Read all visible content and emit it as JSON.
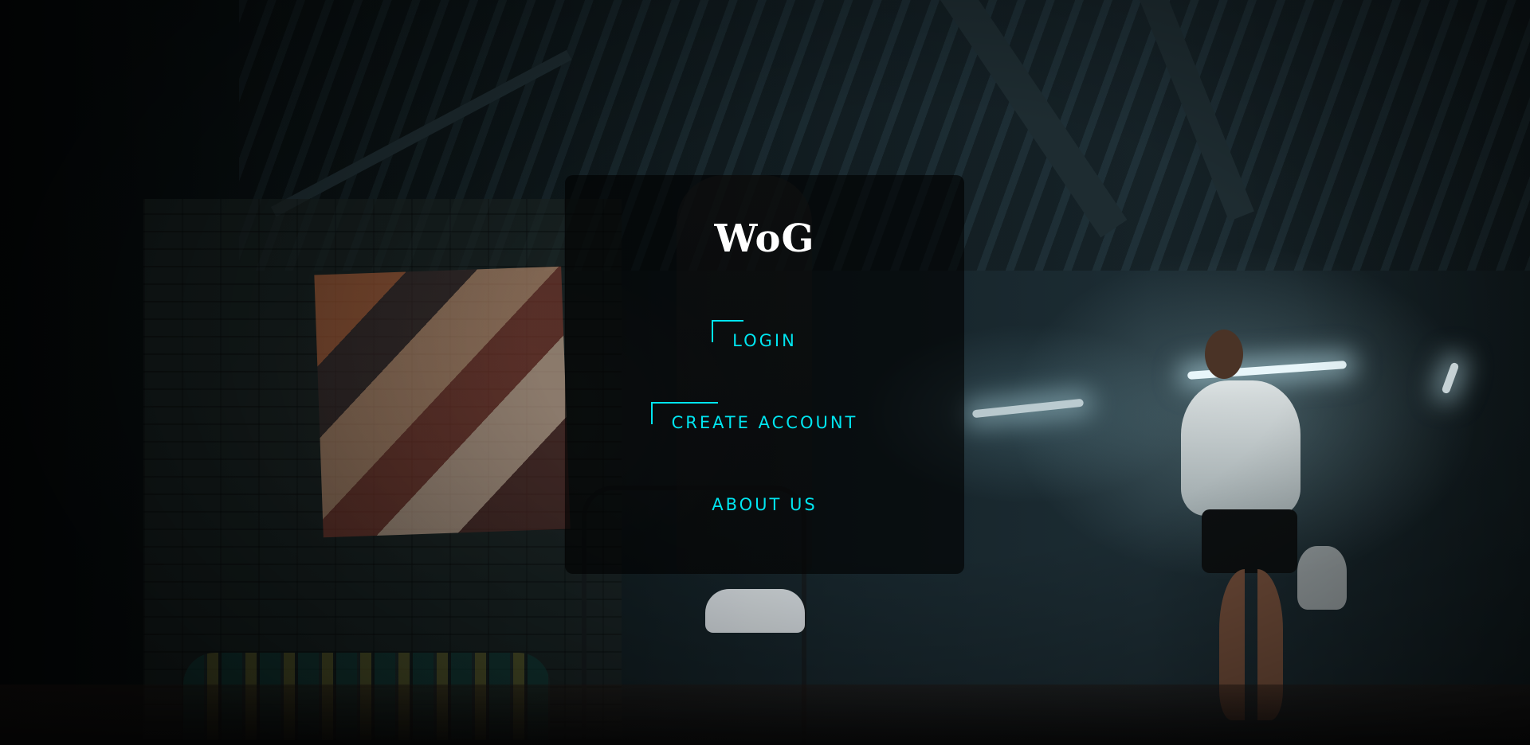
{
  "brand": {
    "title": "WoG"
  },
  "menu": {
    "login_label": "LOGIN",
    "create_account_label": "CREATE ACCOUNT",
    "about_label": "ABOUT US"
  },
  "colors": {
    "accent": "#00e5f0",
    "title": "#ffffff",
    "panel_bg": "rgba(0,0,0,0.62)"
  }
}
